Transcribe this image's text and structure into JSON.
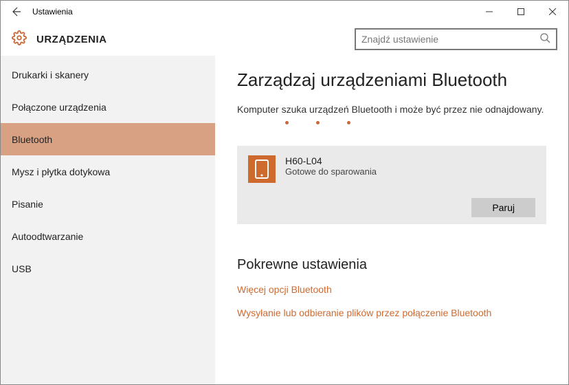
{
  "window": {
    "title": "Ustawienia"
  },
  "header": {
    "title": "URZĄDZENIA"
  },
  "search": {
    "placeholder": "Znajdź ustawienie"
  },
  "sidebar": {
    "items": [
      {
        "label": "Drukarki i skanery"
      },
      {
        "label": "Połączone urządzenia"
      },
      {
        "label": "Bluetooth"
      },
      {
        "label": "Mysz i płytka dotykowa"
      },
      {
        "label": "Pisanie"
      },
      {
        "label": "Autoodtwarzanie"
      },
      {
        "label": "USB"
      }
    ],
    "active_index": 2
  },
  "main": {
    "heading": "Zarządzaj urządzeniami Bluetooth",
    "status": "Komputer szuka urządzeń Bluetooth i może być przez nie odnajdowany.",
    "device": {
      "name": "H60-L04",
      "status": "Gotowe do sparowania",
      "pair_label": "Paruj"
    },
    "related_heading": "Pokrewne ustawienia",
    "links": [
      "Więcej opcji Bluetooth",
      "Wysyłanie lub odbieranie plików przez połączenie Bluetooth"
    ]
  },
  "colors": {
    "accent": "#cf6a2f"
  }
}
